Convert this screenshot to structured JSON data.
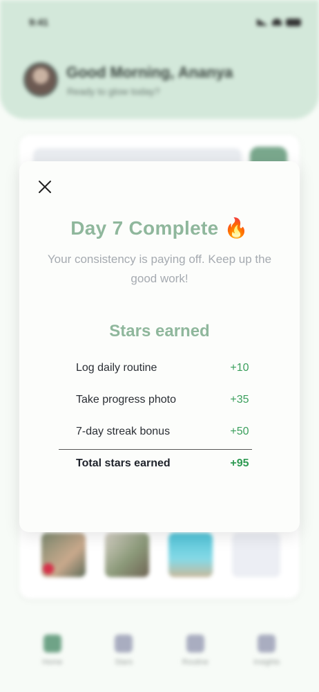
{
  "status_bar": {
    "time": "9:41"
  },
  "header": {
    "greeting": "Good Morning, Ananya",
    "subtitle": "Ready to glow today?"
  },
  "bottom_nav": {
    "items": [
      {
        "label": "Home",
        "icon": "home-icon"
      },
      {
        "label": "Stars",
        "icon": "star-icon"
      },
      {
        "label": "Routine",
        "icon": "grid-icon"
      },
      {
        "label": "Insights",
        "icon": "plus-icon"
      }
    ]
  },
  "modal": {
    "title": "Day 7 Complete",
    "title_emoji": "🔥",
    "subtitle": "Your consistency is paying off. Keep up the good work!",
    "stars_heading": "Stars earned",
    "rows": [
      {
        "label": "Log daily routine",
        "points": "+10"
      },
      {
        "label": "Take progress photo",
        "points": "+35"
      },
      {
        "label": "7-day streak bonus",
        "points": "+50"
      }
    ],
    "total": {
      "label": "Total stars earned",
      "points": "+95"
    }
  },
  "colors": {
    "accent": "#8fb79c",
    "points_green": "#3a9f5c",
    "header_bg": "#d3e8da"
  }
}
